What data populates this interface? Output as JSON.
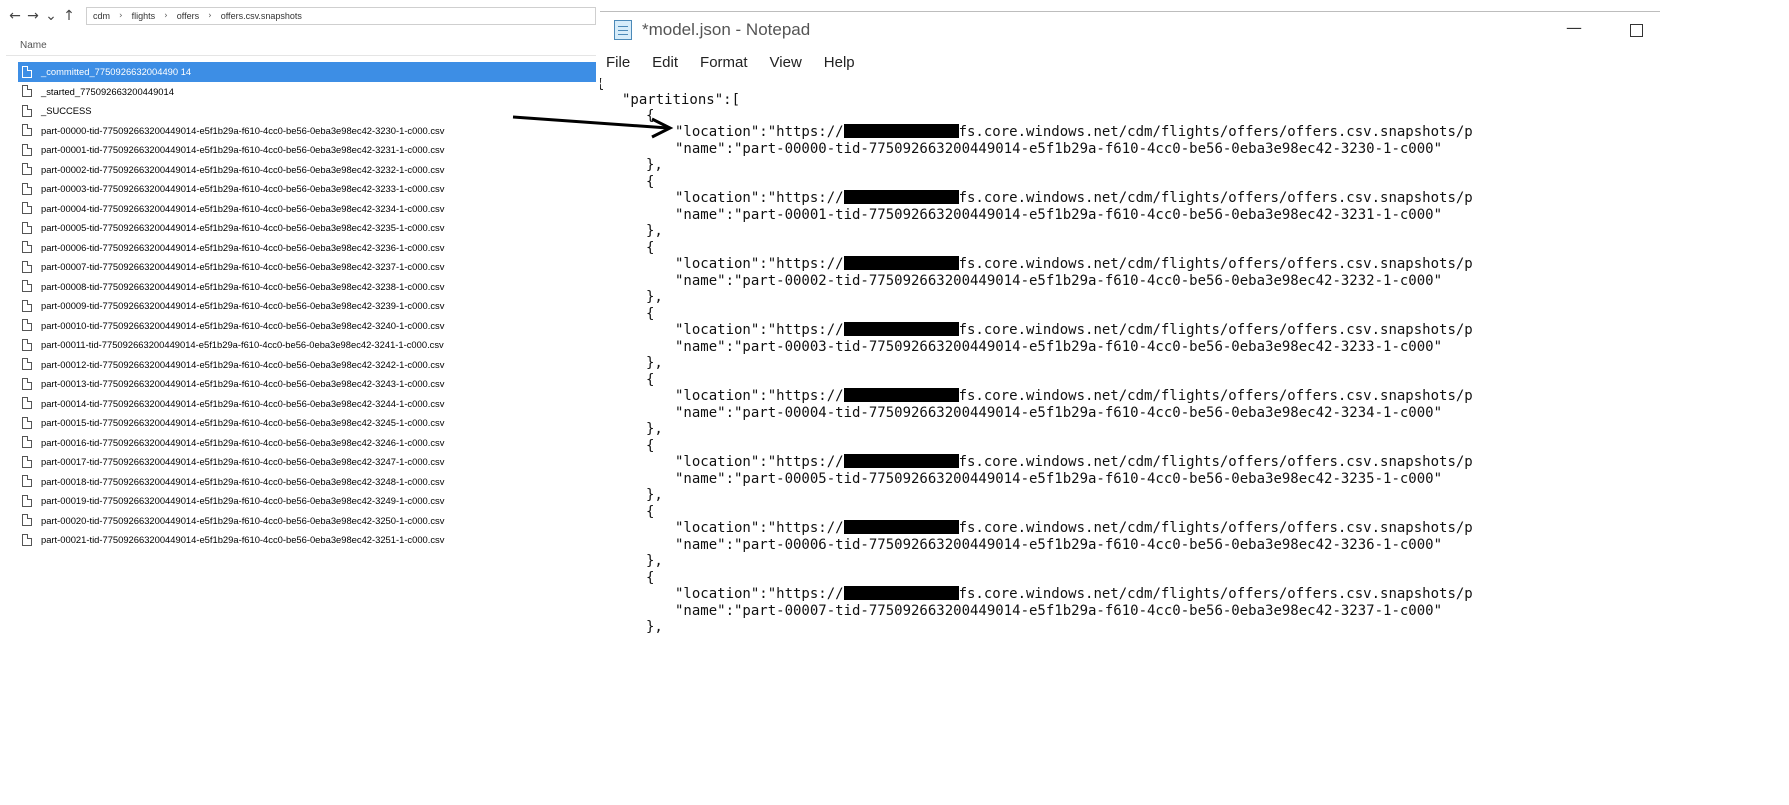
{
  "explorer": {
    "nav_back": "←",
    "nav_forward": "→",
    "nav_recent": "⌄",
    "nav_up": "↑",
    "breadcrumbs": [
      "cdm",
      "flights",
      "offers",
      "offers.csv.snapshots"
    ],
    "breadcrumb_separator": "›",
    "column_name": "Name",
    "files": [
      "_committed_7750926632004490 14",
      "_started_775092663200449014",
      "_SUCCESS",
      "part-00000-tid-775092663200449014-e5f1b29a-f610-4cc0-be56-0eba3e98ec42-3230-1-c000.csv",
      "part-00001-tid-775092663200449014-e5f1b29a-f610-4cc0-be56-0eba3e98ec42-3231-1-c000.csv",
      "part-00002-tid-775092663200449014-e5f1b29a-f610-4cc0-be56-0eba3e98ec42-3232-1-c000.csv",
      "part-00003-tid-775092663200449014-e5f1b29a-f610-4cc0-be56-0eba3e98ec42-3233-1-c000.csv",
      "part-00004-tid-775092663200449014-e5f1b29a-f610-4cc0-be56-0eba3e98ec42-3234-1-c000.csv",
      "part-00005-tid-775092663200449014-e5f1b29a-f610-4cc0-be56-0eba3e98ec42-3235-1-c000.csv",
      "part-00006-tid-775092663200449014-e5f1b29a-f610-4cc0-be56-0eba3e98ec42-3236-1-c000.csv",
      "part-00007-tid-775092663200449014-e5f1b29a-f610-4cc0-be56-0eba3e98ec42-3237-1-c000.csv",
      "part-00008-tid-775092663200449014-e5f1b29a-f610-4cc0-be56-0eba3e98ec42-3238-1-c000.csv",
      "part-00009-tid-775092663200449014-e5f1b29a-f610-4cc0-be56-0eba3e98ec42-3239-1-c000.csv",
      "part-00010-tid-775092663200449014-e5f1b29a-f610-4cc0-be56-0eba3e98ec42-3240-1-c000.csv",
      "part-00011-tid-775092663200449014-e5f1b29a-f610-4cc0-be56-0eba3e98ec42-3241-1-c000.csv",
      "part-00012-tid-775092663200449014-e5f1b29a-f610-4cc0-be56-0eba3e98ec42-3242-1-c000.csv",
      "part-00013-tid-775092663200449014-e5f1b29a-f610-4cc0-be56-0eba3e98ec42-3243-1-c000.csv",
      "part-00014-tid-775092663200449014-e5f1b29a-f610-4cc0-be56-0eba3e98ec42-3244-1-c000.csv",
      "part-00015-tid-775092663200449014-e5f1b29a-f610-4cc0-be56-0eba3e98ec42-3245-1-c000.csv",
      "part-00016-tid-775092663200449014-e5f1b29a-f610-4cc0-be56-0eba3e98ec42-3246-1-c000.csv",
      "part-00017-tid-775092663200449014-e5f1b29a-f610-4cc0-be56-0eba3e98ec42-3247-1-c000.csv",
      "part-00018-tid-775092663200449014-e5f1b29a-f610-4cc0-be56-0eba3e98ec42-3248-1-c000.csv",
      "part-00019-tid-775092663200449014-e5f1b29a-f610-4cc0-be56-0eba3e98ec42-3249-1-c000.csv",
      "part-00020-tid-775092663200449014-e5f1b29a-f610-4cc0-be56-0eba3e98ec42-3250-1-c000.csv",
      "part-00021-tid-775092663200449014-e5f1b29a-f610-4cc0-be56-0eba3e98ec42-3251-1-c000.csv"
    ],
    "selected_index": 0,
    "selection_color": "#3d8ee5"
  },
  "notepad": {
    "title": "*model.json - Notepad",
    "btn_minimize": "—",
    "menu": [
      "File",
      "Edit",
      "Format",
      "View",
      "Help"
    ],
    "lines": {
      "open_brace": "{",
      "partitions_key": "\"partitions\":[",
      "item_open": "{",
      "item_close": "},",
      "location_prefix": "\"location\":\"https://",
      "location_suffix": "fs.core.windows.net/cdm/flights/offers/offers.csv.snapshots/p"
    },
    "partitions": [
      {
        "name": "\"name\":\"part-00000-tid-775092663200449014-e5f1b29a-f610-4cc0-be56-0eba3e98ec42-3230-1-c000\""
      },
      {
        "name": "\"name\":\"part-00001-tid-775092663200449014-e5f1b29a-f610-4cc0-be56-0eba3e98ec42-3231-1-c000\""
      },
      {
        "name": "\"name\":\"part-00002-tid-775092663200449014-e5f1b29a-f610-4cc0-be56-0eba3e98ec42-3232-1-c000\""
      },
      {
        "name": "\"name\":\"part-00003-tid-775092663200449014-e5f1b29a-f610-4cc0-be56-0eba3e98ec42-3233-1-c000\""
      },
      {
        "name": "\"name\":\"part-00004-tid-775092663200449014-e5f1b29a-f610-4cc0-be56-0eba3e98ec42-3234-1-c000\""
      },
      {
        "name": "\"name\":\"part-00005-tid-775092663200449014-e5f1b29a-f610-4cc0-be56-0eba3e98ec42-3235-1-c000\""
      },
      {
        "name": "\"name\":\"part-00006-tid-775092663200449014-e5f1b29a-f610-4cc0-be56-0eba3e98ec42-3236-1-c000\""
      },
      {
        "name": "\"name\":\"part-00007-tid-775092663200449014-e5f1b29a-f610-4cc0-be56-0eba3e98ec42-3237-1-c000\""
      }
    ]
  }
}
